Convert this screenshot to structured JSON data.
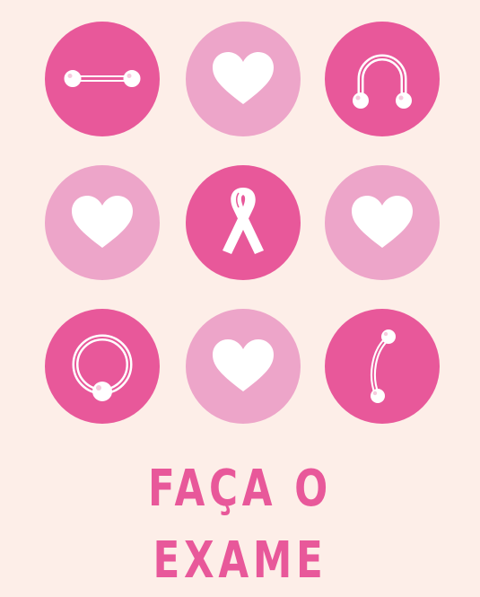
{
  "headline": "FAÇA O EXAME",
  "colors": {
    "background": "#fdeee8",
    "circle_dark": "#e8589a",
    "circle_light": "#eda5c9",
    "headline": "#e8589a",
    "icon": "#ffffff"
  },
  "tiles": [
    {
      "icon": "barbell-piercing-icon",
      "circle": "dark"
    },
    {
      "icon": "heart-icon",
      "circle": "light"
    },
    {
      "icon": "horseshoe-piercing-icon",
      "circle": "dark"
    },
    {
      "icon": "heart-icon",
      "circle": "light"
    },
    {
      "icon": "awareness-ribbon-icon",
      "circle": "dark"
    },
    {
      "icon": "heart-icon",
      "circle": "light"
    },
    {
      "icon": "captive-ring-piercing-icon",
      "circle": "dark"
    },
    {
      "icon": "heart-icon",
      "circle": "light"
    },
    {
      "icon": "curved-barbell-piercing-icon",
      "circle": "dark"
    }
  ]
}
